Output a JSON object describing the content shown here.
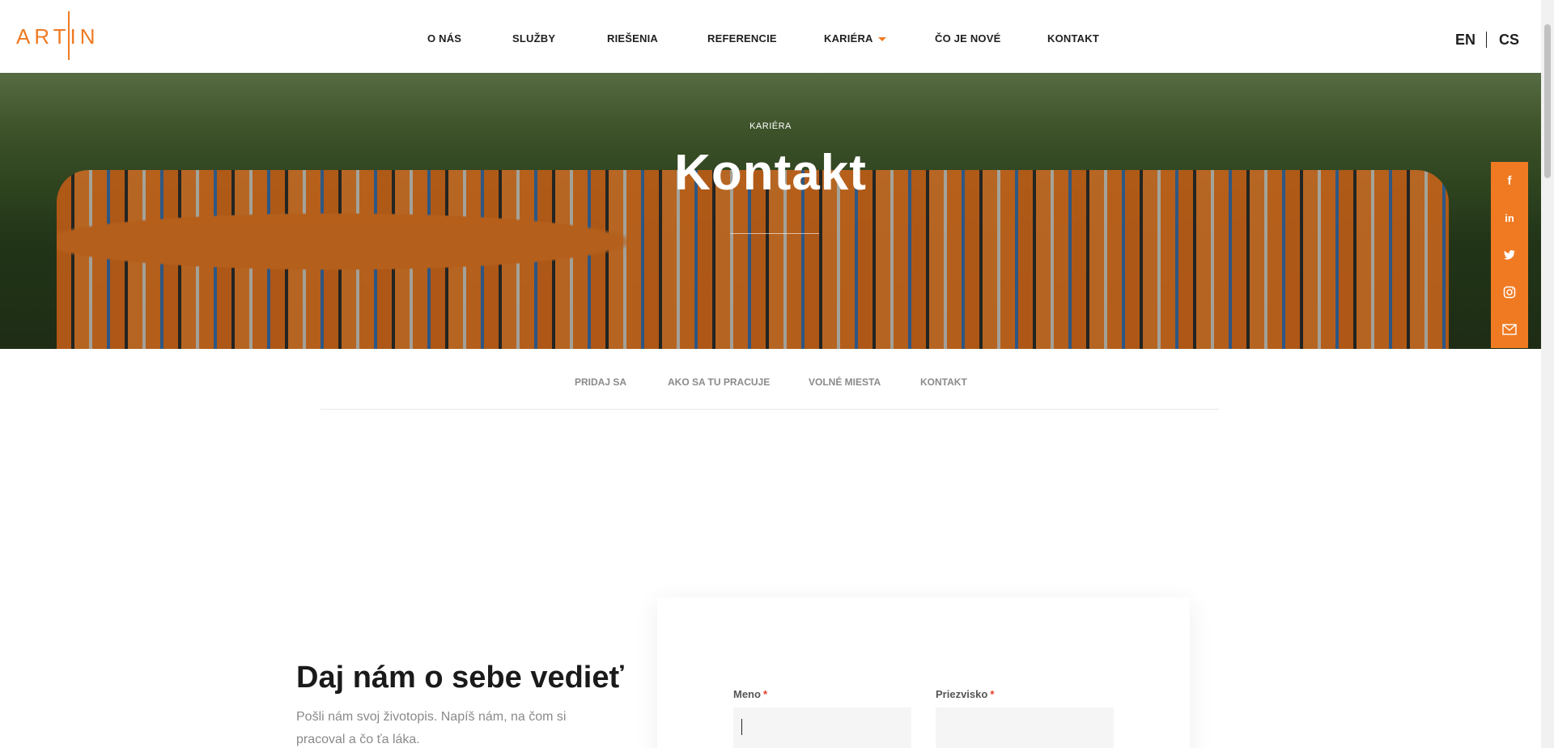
{
  "header": {
    "logo_text": "ARTIN",
    "nav": [
      {
        "label": "O NÁS"
      },
      {
        "label": "SLUŽBY"
      },
      {
        "label": "RIEŠENIA"
      },
      {
        "label": "REFERENCIE"
      },
      {
        "label": "KARIÉRA",
        "has_dropdown": true
      },
      {
        "label": "ČO JE NOVÉ"
      },
      {
        "label": "KONTAKT"
      }
    ],
    "languages": [
      "EN",
      "CS"
    ]
  },
  "hero": {
    "kicker": "KARIÉRA",
    "title": "Kontakt"
  },
  "social": {
    "icons": [
      "facebook-icon",
      "linkedin-icon",
      "twitter-icon",
      "instagram-icon",
      "mail-icon"
    ],
    "glyphs": [
      "f",
      "in"
    ]
  },
  "subnav": {
    "items": [
      "PRIDAJ SA",
      "AKO SA TU PRACUJE",
      "VOLNÉ MIESTA",
      "KONTAKT"
    ]
  },
  "content": {
    "heading": "Daj nám o sebe vedieť",
    "lead": "Pošli nám svoj životopis. Napíš nám, na čom si pracoval a čo ťa láka."
  },
  "form": {
    "first_name": {
      "label": "Meno",
      "required_mark": "*",
      "value": ""
    },
    "last_name": {
      "label": "Priezvisko",
      "required_mark": "*",
      "value": ""
    }
  },
  "colors": {
    "accent": "#f07a22",
    "required": "#e43b2c"
  }
}
